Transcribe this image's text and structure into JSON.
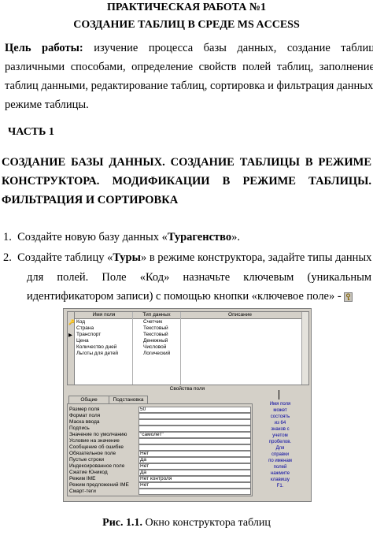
{
  "title_line1": "ПРАКТИЧЕСКАЯ РАБОТА №1",
  "title_line2": "СОЗДАНИЕ ТАБЛИЦ В СРЕДЕ MS ACCESS",
  "goal": {
    "label": "Цель работы:",
    "lines": [
      "изучение процесса базы данных, создание таблиц",
      "различными способами, определение свойств полей таблиц, заполнение",
      "таблиц данными, редактирование таблиц, сортировка и фильтрация данных в",
      "режиме таблицы."
    ]
  },
  "part": "ЧАСТЬ 1",
  "section_heading": [
    "СОЗДАНИЕ БАЗЫ ДАННЫХ. СОЗДАНИЕ ТАБЛИЦЫ В РЕЖИМЕ",
    "КОНСТРУКТОРА. МОДИФИКАЦИИ В РЕЖИМЕ ТАБЛИЦЫ.",
    "ФИЛЬТРАЦИЯ И СОРТИРОВКА"
  ],
  "steps": [
    {
      "num": "1.",
      "before": "Создайте новую базу данных «",
      "bold": "Турагенство",
      "after": "»."
    },
    {
      "num": "2.",
      "before": "Создайте таблицу «",
      "bold": "Туры",
      "after": "» в режиме конструктора, задайте типы данных"
    }
  ],
  "step2_cont": [
    "для полей. Поле «Код» назначьте ключевым (уникальным",
    "идентификатором записи) с помощью кнопки «ключевое поле» -"
  ],
  "designer": {
    "columns": [
      "Имя поля",
      "Тип данных",
      "Описание"
    ],
    "rows": [
      {
        "name": "Код",
        "type": "Счетчик",
        "key": true
      },
      {
        "name": "Страна",
        "type": "Текстовый"
      },
      {
        "name": "Транспорт",
        "type": "Текстовый",
        "current": true
      },
      {
        "name": "Цена",
        "type": "Денежный"
      },
      {
        "name": "Количество дней",
        "type": "Числовой"
      },
      {
        "name": "Льготы для детей",
        "type": "Логический"
      }
    ],
    "props_title": "Свойства поля",
    "tabs": [
      "Общие",
      "Подстановка"
    ],
    "props": [
      {
        "label": "Размер поля",
        "value": "50"
      },
      {
        "label": "Формат поля",
        "value": ""
      },
      {
        "label": "Маска ввода",
        "value": ""
      },
      {
        "label": "Подпись",
        "value": ""
      },
      {
        "label": "Значение по умолчанию",
        "value": "\"самолёт\""
      },
      {
        "label": "Условие на значение",
        "value": ""
      },
      {
        "label": "Сообщение об ошибке",
        "value": ""
      },
      {
        "label": "Обязательное поле",
        "value": "Нет"
      },
      {
        "label": "Пустые строки",
        "value": "Да"
      },
      {
        "label": "Индексированное поле",
        "value": "Нет"
      },
      {
        "label": "Сжатие Юникод",
        "value": "Да"
      },
      {
        "label": "Режим IME",
        "value": "Нет контроля"
      },
      {
        "label": "Режим предложений IME",
        "value": "Нет"
      },
      {
        "label": "Смарт-теги",
        "value": ""
      }
    ],
    "hint": [
      "Имя поля",
      "может",
      "состоять",
      "из 64",
      "знаков с",
      "учетом",
      "пробелов.",
      "Для",
      "справки",
      "по именам",
      "полей",
      "нажмите",
      "клавишу",
      "F1."
    ]
  },
  "caption_bold": "Рис. 1.1.",
  "caption_rest": " Окно конструктора таблиц"
}
